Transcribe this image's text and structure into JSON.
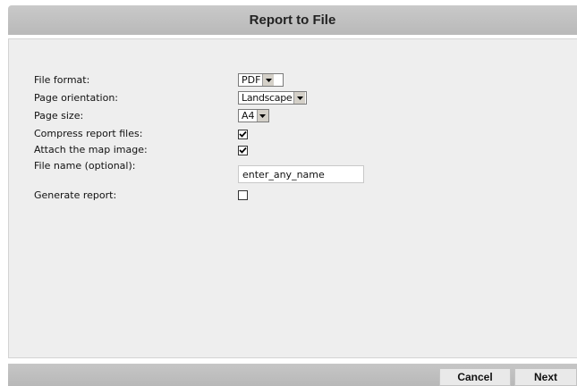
{
  "dialog": {
    "title": "Report to File"
  },
  "form": {
    "file_format": {
      "label": "File format:",
      "value": "PDF"
    },
    "page_orientation": {
      "label": "Page orientation:",
      "value": "Landscape"
    },
    "page_size": {
      "label": "Page size:",
      "value": "A4"
    },
    "compress_report_files": {
      "label": "Compress report files:",
      "checked": true
    },
    "attach_map_image": {
      "label": "Attach the map image:",
      "checked": true
    },
    "file_name": {
      "label": "File name (optional):",
      "value": "enter_any_name"
    },
    "generate_report": {
      "label": "Generate report:",
      "checked": false
    }
  },
  "footer": {
    "cancel_label": "Cancel",
    "next_label": "Next"
  },
  "icons": {
    "dropdown": "chevron-down-icon",
    "check": "checkmark-icon"
  },
  "colors": {
    "title_bar": "#c2c2c2",
    "content_bg": "#eeeeee",
    "button_bg": "#e9e9e9"
  }
}
